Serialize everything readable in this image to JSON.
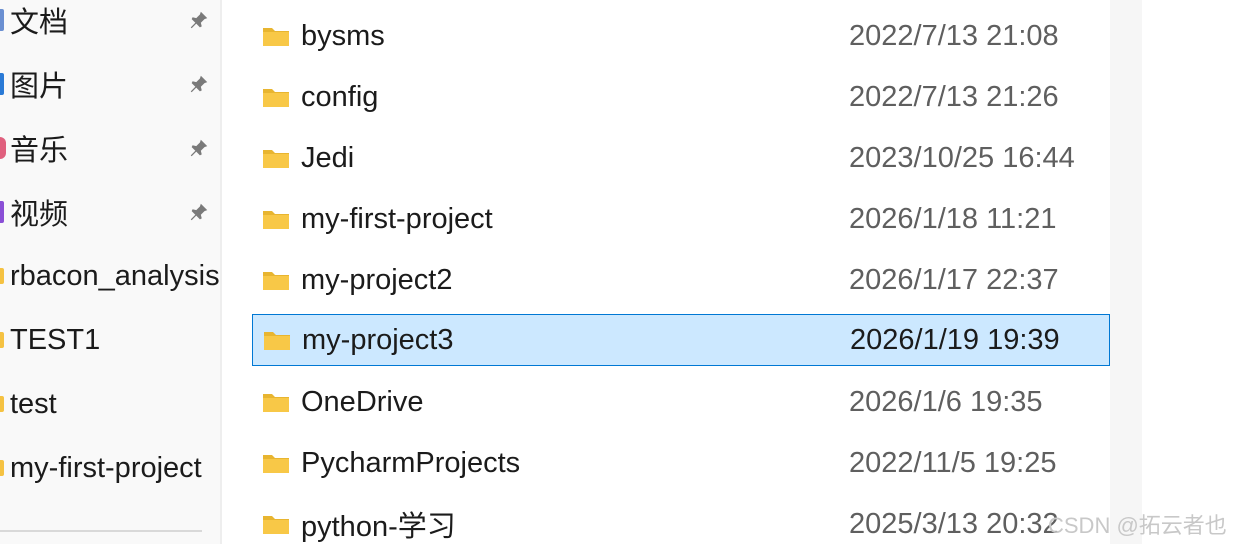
{
  "sidebar": {
    "items": [
      {
        "label": "文档",
        "pinned": true,
        "marker_color": "#6a8fd1"
      },
      {
        "label": "图片",
        "pinned": true,
        "marker_color": "#2a7ad6"
      },
      {
        "label": "音乐",
        "pinned": true,
        "marker_color": "#e0607e"
      },
      {
        "label": "视频",
        "pinned": true,
        "marker_color": "#8a4fd6"
      },
      {
        "label": "rbacon_analysis",
        "pinned": false,
        "marker_color": "#f5c242"
      },
      {
        "label": "TEST1",
        "pinned": false,
        "marker_color": "#f5c242"
      },
      {
        "label": "test",
        "pinned": false,
        "marker_color": "#f5c242"
      },
      {
        "label": "my-first-project",
        "pinned": false,
        "marker_color": "#f5c242"
      }
    ],
    "pin_icon": "pin-icon"
  },
  "files": [
    {
      "name": "bysms",
      "modified": "2022/7/13 21:08",
      "selected": false
    },
    {
      "name": "config",
      "modified": "2022/7/13 21:26",
      "selected": false
    },
    {
      "name": "Jedi",
      "modified": "2023/10/25 16:44",
      "selected": false
    },
    {
      "name": "my-first-project",
      "modified": "2026/1/18 11:21",
      "selected": false
    },
    {
      "name": "my-project2",
      "modified": "2026/1/17 22:37",
      "selected": false
    },
    {
      "name": "my-project3",
      "modified": "2026/1/19 19:39",
      "selected": true
    },
    {
      "name": "OneDrive",
      "modified": "2026/1/6 19:35",
      "selected": false
    },
    {
      "name": "PycharmProjects",
      "modified": "2022/11/5 19:25",
      "selected": false
    },
    {
      "name": "python-学习",
      "modified": "2025/3/13 20:32",
      "selected": false
    }
  ],
  "folder_icon": "folder-icon",
  "colors": {
    "selection_bg": "#cce8ff",
    "selection_border": "#0078d4",
    "folder": "#f8c847"
  },
  "watermark": "CSDN @拓云者也"
}
